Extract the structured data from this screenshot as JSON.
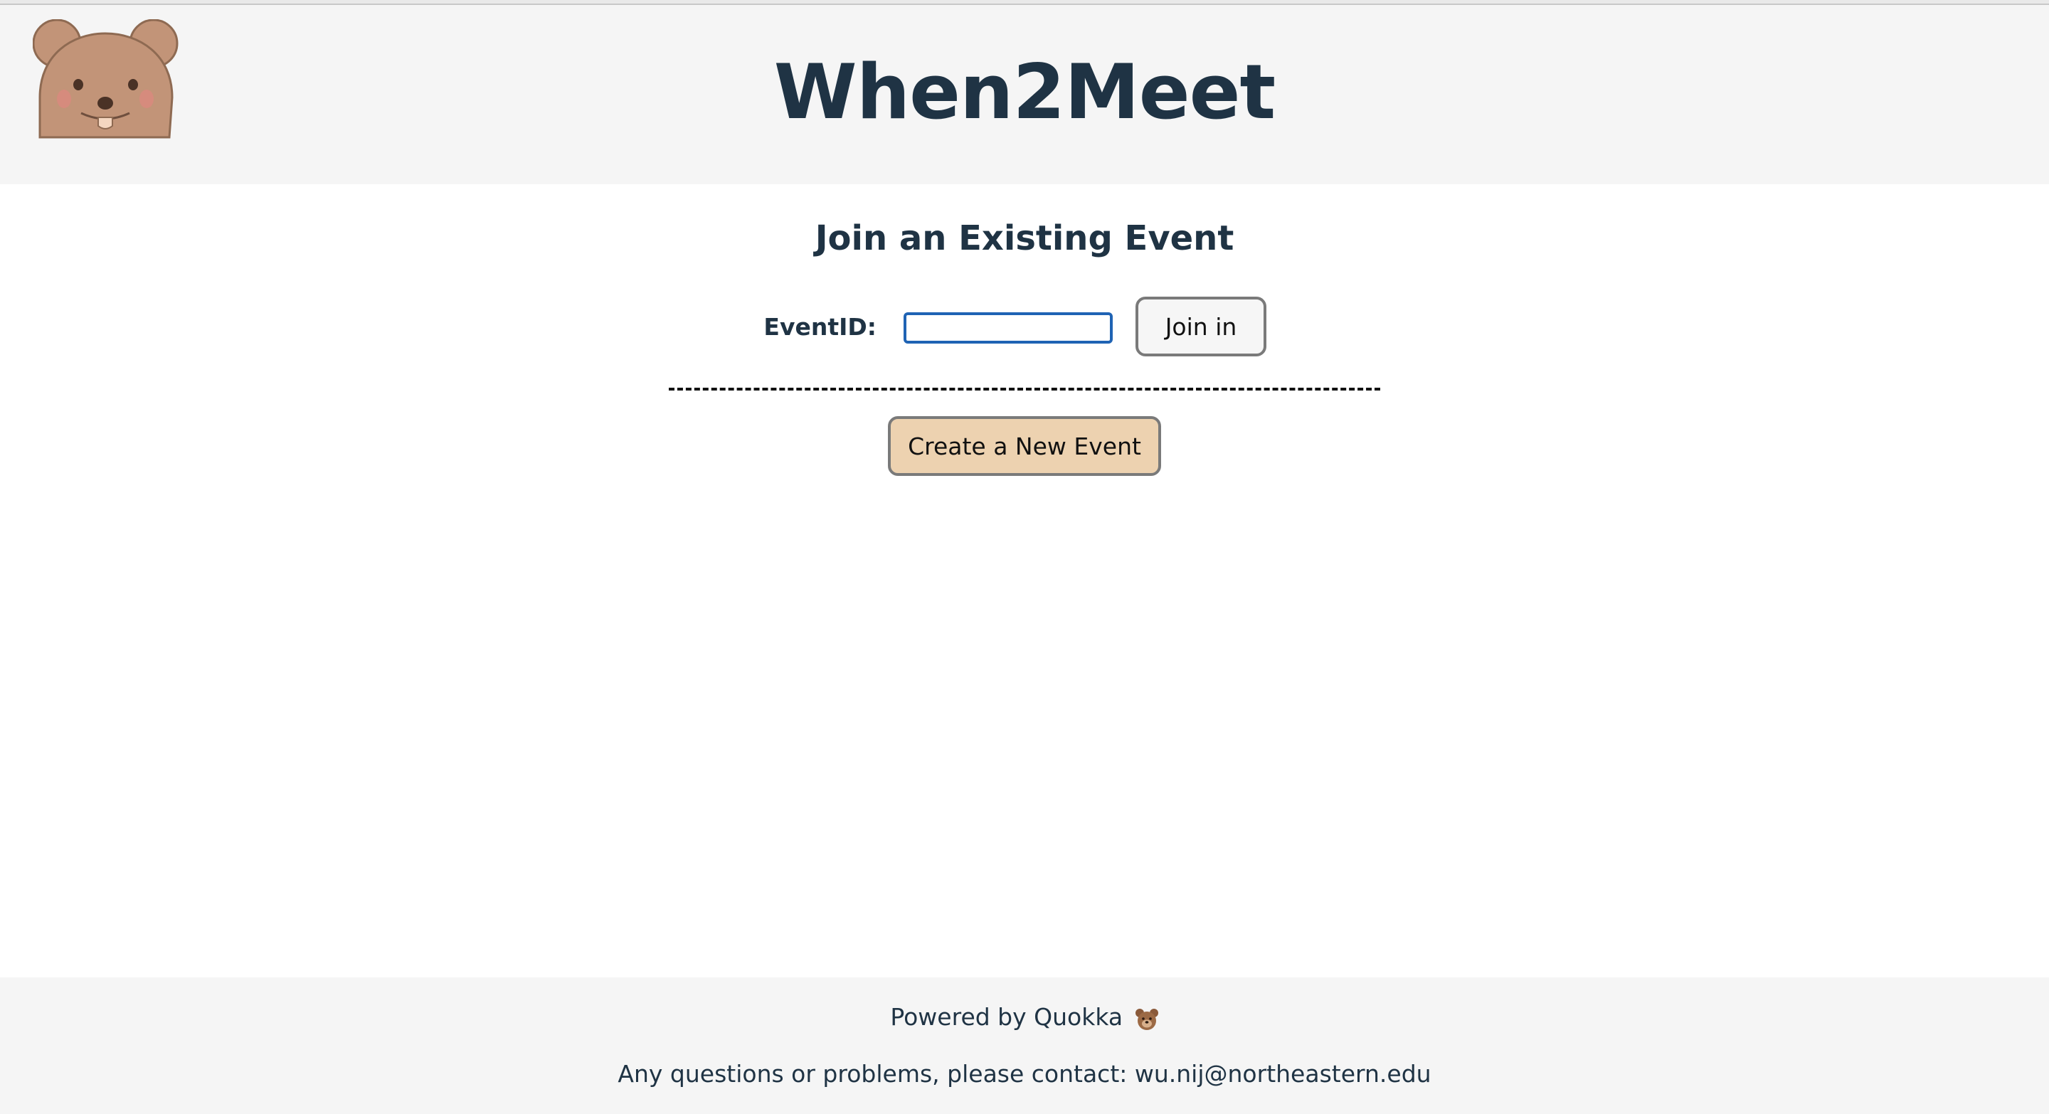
{
  "header": {
    "app_title": "When2Meet",
    "logo_icon": "quokka-bear-logo-icon"
  },
  "main": {
    "section_heading": "Join an Existing Event",
    "event_id_label": "EventID:",
    "event_id_value": "",
    "join_button_label": "Join in",
    "create_button_label": "Create a New Event"
  },
  "footer": {
    "powered_by": "Powered by Quokka",
    "powered_icon": "bear-face-icon",
    "contact_text": "Any questions or problems, please contact: wu.nij@northeastern.edu"
  },
  "colors": {
    "header_bg": "#f5f5f5",
    "title_text": "#1f3344",
    "input_focus_border": "#1f63b4",
    "create_button_bg": "#edd2b0",
    "logo_fur": "#c29478"
  }
}
